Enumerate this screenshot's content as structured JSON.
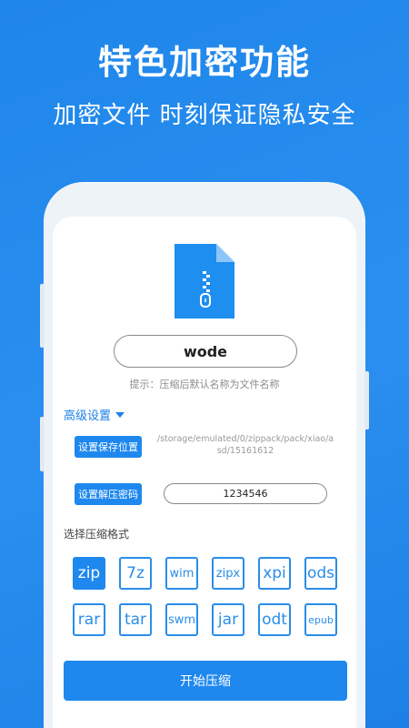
{
  "promo": {
    "headline": "特色加密功能",
    "subline": "加密文件 时刻保证隐私安全"
  },
  "icons": {
    "file": "zip-file-icon",
    "dropdown": "triangle-down-icon"
  },
  "colors": {
    "brand": "#1f88ee",
    "background": "#2a8ff0"
  },
  "app": {
    "file_name": "wode",
    "hint": "提示：压缩后默认名称为文件名称",
    "advanced_label": "高级设置",
    "save_location_button": "设置保存位置",
    "save_path": "/storage/emulated/0/zippack/pack/xiao/asd/15161612",
    "password_button": "设置解压密码",
    "password": "1234546",
    "format_label": "选择压缩格式",
    "formats": [
      "zip",
      "7z",
      "wim",
      "zipx",
      "xpi",
      "ods",
      "rar",
      "tar",
      "swm",
      "jar",
      "odt",
      "epub"
    ],
    "selected_format": "zip",
    "start_button": "开始压缩"
  }
}
